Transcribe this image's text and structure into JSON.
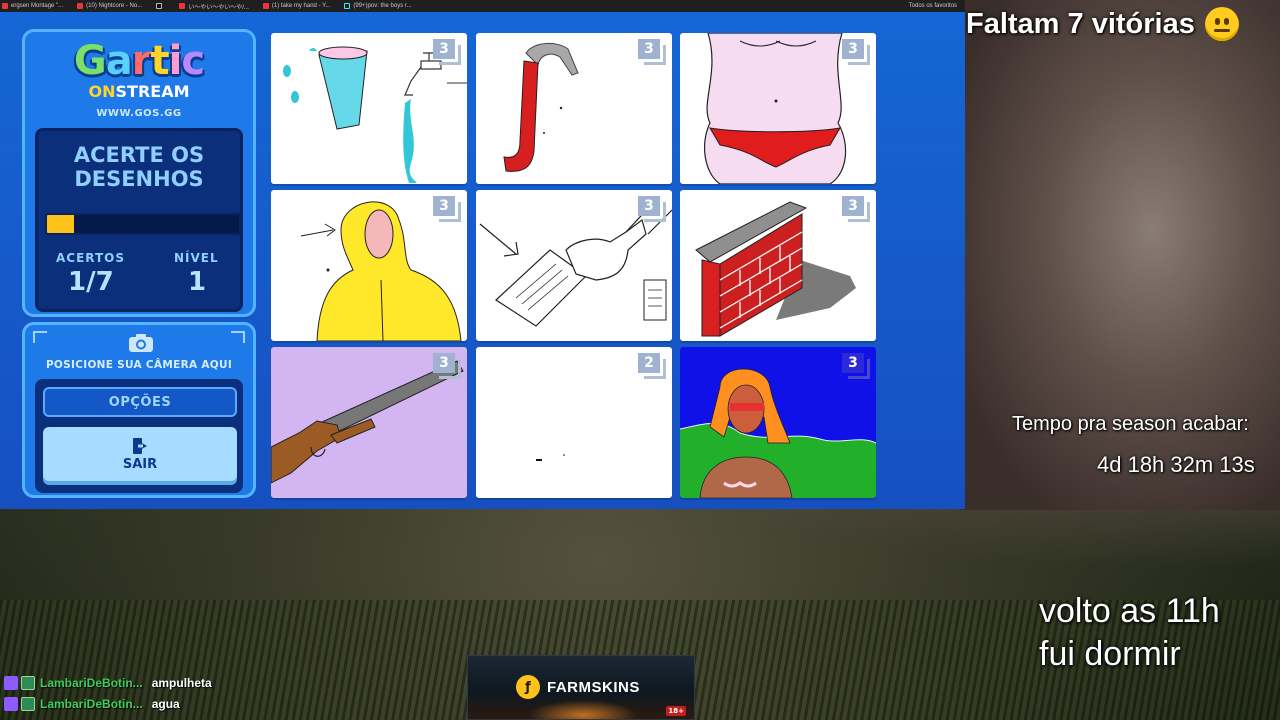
{
  "browser": {
    "tabs": [
      {
        "label": "ergsen Montage \"...",
        "icon": "youtube-icon"
      },
      {
        "label": "(10) Nightcore - No...",
        "icon": "youtube-icon"
      },
      {
        "label": "",
        "icon": "x-icon"
      },
      {
        "label": "い〜やい〜やい〜や/...",
        "icon": "youtube-icon"
      },
      {
        "label": "(1) take my hand - Y...",
        "icon": "youtube-icon"
      },
      {
        "label": "(99+)pov: the boys r...",
        "icon": "tiktok-icon"
      }
    ],
    "favorites_label": "Todos os favoritos"
  },
  "game": {
    "logo_title": "Gartic",
    "logo_on": "ON",
    "logo_stream": "STREAM",
    "logo_url": "WWW.GOS.GG",
    "panel_title_line1": "ACERTE OS",
    "panel_title_line2": "DESENHOS",
    "progress": 0.142857,
    "acertos_label": "ACERTOS",
    "acertos_value": "1/7",
    "nivel_label": "NÍVEL",
    "nivel_value": "1",
    "camera_text": "POSICIONE SUA CÂMERA AQUI",
    "options_button": "OPÇÕES",
    "exit_button": "SAIR",
    "colors": {
      "accent": "#ffc21a",
      "panel_dark": "#0c2f7c",
      "panel_light": "#1e7ae8"
    },
    "cards": [
      {
        "count": "3",
        "subject": "glass-and-faucet-drawing"
      },
      {
        "count": "3",
        "subject": "red-pipe-drawing"
      },
      {
        "count": "3",
        "subject": "bikini-body-drawing"
      },
      {
        "count": "3",
        "subject": "yellow-raincoat-drawing"
      },
      {
        "count": "3",
        "subject": "handing-paper-drawing"
      },
      {
        "count": "3",
        "subject": "brick-wall-drawing"
      },
      {
        "count": "3",
        "subject": "shotgun-drawing"
      },
      {
        "count": "2",
        "subject": "blank-canvas-drawing"
      },
      {
        "count": "3",
        "subject": "woman-landscape-drawing"
      }
    ]
  },
  "overlay": {
    "wins_text": "Faltam 7 vitórias",
    "season_label": "Tempo pra season acabar:",
    "season_timer": "4d 18h 32m 13s",
    "note_line1": "volto as 11h",
    "note_line2": "fui dormir"
  },
  "chat": [
    {
      "user": "LambariDeBotin...",
      "message": "ampulheta"
    },
    {
      "user": "LambariDeBotin...",
      "message": "agua"
    }
  ],
  "sponsor": {
    "name": "FARMSKINS",
    "age_badge": "18+"
  }
}
